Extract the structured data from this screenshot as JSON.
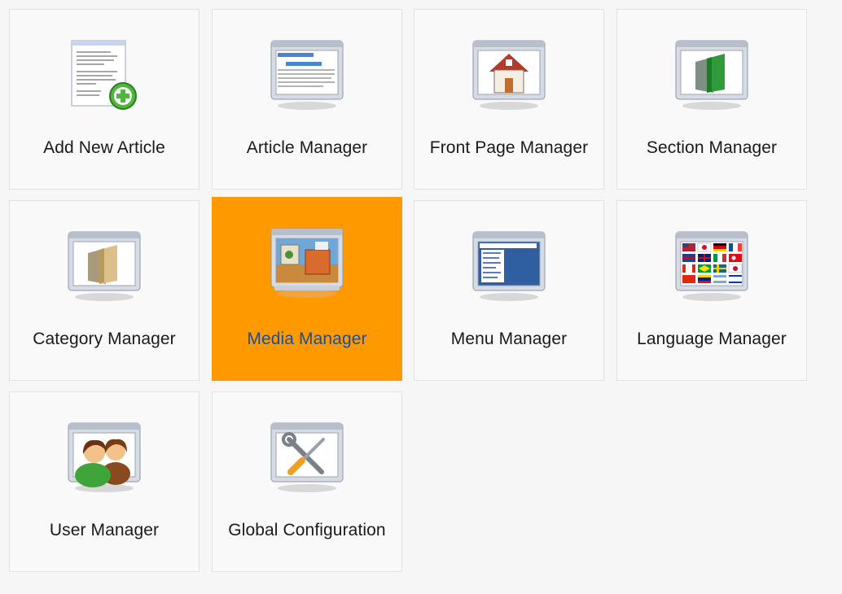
{
  "tiles": [
    {
      "id": "add-new-article",
      "label": "Add New Article",
      "icon": "add-article-icon",
      "active": false
    },
    {
      "id": "article-manager",
      "label": "Article Manager",
      "icon": "article-manager-icon",
      "active": false
    },
    {
      "id": "front-page-manager",
      "label": "Front Page Manager",
      "icon": "home-icon",
      "active": false
    },
    {
      "id": "section-manager",
      "label": "Section Manager",
      "icon": "green-folder-icon",
      "active": false
    },
    {
      "id": "category-manager",
      "label": "Category Manager",
      "icon": "folder-icon",
      "active": false
    },
    {
      "id": "media-manager",
      "label": "Media Manager",
      "icon": "media-icon",
      "active": true
    },
    {
      "id": "menu-manager",
      "label": "Menu Manager",
      "icon": "menu-icon",
      "active": false
    },
    {
      "id": "language-manager",
      "label": "Language Manager",
      "icon": "flags-icon",
      "active": false
    },
    {
      "id": "user-manager",
      "label": "User Manager",
      "icon": "users-icon",
      "active": false
    },
    {
      "id": "global-configuration",
      "label": "Global Configuration",
      "icon": "tools-icon",
      "active": false
    }
  ],
  "colors": {
    "active_tile": "#ff9900",
    "active_label": "#1f4e8c",
    "tile_bg": "#f9f9f9"
  }
}
